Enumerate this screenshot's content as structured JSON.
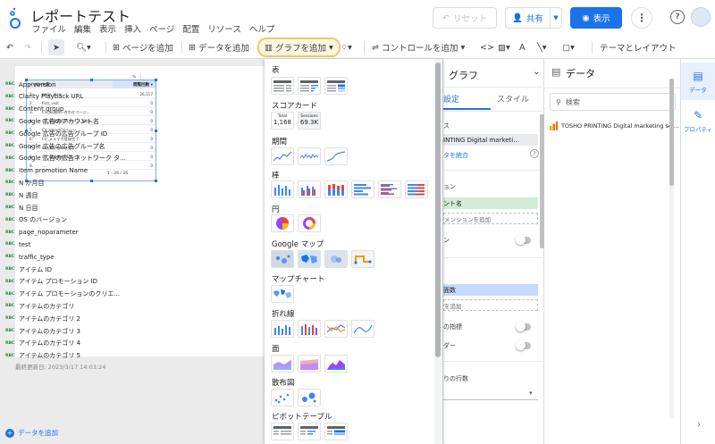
{
  "header": {
    "title": "レポートテスト",
    "menu": [
      "ファイル",
      "編集",
      "表示",
      "挿入",
      "ページ",
      "配置",
      "リソース",
      "ヘルプ"
    ],
    "reset_label": "リセット",
    "share_label": "共有",
    "view_label": "表示"
  },
  "toolbar": {
    "add_page": "ページを追加",
    "add_data": "データを追加",
    "add_chart": "グラフを追加",
    "add_control": "コントロールを追加",
    "theme_layout": "テーマとレイアウト"
  },
  "canvas": {
    "updated": "最終更新日: 2023/3/17 14:03:24",
    "table": {
      "col1": "イベント名",
      "col2": "閲覧回数 ▾",
      "rows": [
        {
          "n": "1.",
          "name": "page_view",
          "val": "26,117"
        },
        {
          "n": "2.",
          "name": "first_visit",
          "val": "0"
        },
        {
          "n": "3.",
          "name": "CV_新規問い合わせページ...",
          "val": "0"
        },
        {
          "n": "4.",
          "name": "CV_新規資料DLページ_資料...",
          "val": "0"
        },
        {
          "n": "5.",
          "name": "CV_aboutCVページ",
          "val": "0"
        },
        {
          "n": "6.",
          "name": "CV_メルマガ登録完了",
          "val": "0"
        },
        {
          "n": "7.",
          "name": "CV_問い合わせ完了",
          "val": "0"
        },
        {
          "n": "8.",
          "name": "CV_事業資料DLページ",
          "val": "0"
        },
        {
          "n": "9.",
          "name": "...",
          "val": "0"
        }
      ],
      "pager": "1 - 26 / 26"
    }
  },
  "chart_menu": {
    "categories": [
      "表",
      "スコアカード",
      "期間",
      "棒",
      "円",
      "Google マップ",
      "マップチャート",
      "折れ線",
      "面",
      "散布図",
      "ピボットテーブル"
    ],
    "scorecard": {
      "total_label": "Total",
      "total_value": "1,168",
      "sessions_label": "Sessions",
      "sessions_value": "69.3K"
    }
  },
  "properties": {
    "title": "グラフ",
    "tab_setup": "設定",
    "tab_style": "スタイル",
    "lines": {
      "source": "ス",
      "source_value": "INTING Digital marketi...",
      "merge": "タを統合",
      "dimension_h": "ョン",
      "dimension_value": "ント名",
      "add_dimension": "メンションを追加",
      "drill": "ン",
      "metric_value": "面数",
      "add_metric": "を追加",
      "optional": "の指標",
      "slider": "ダー",
      "rows": "りの行数"
    }
  },
  "data_panel": {
    "title": "データ",
    "search_placeholder": "検索",
    "source": "TOSHO PRINTING Digital marketing sol...",
    "fields": [
      "App version",
      "Clarity Playback URL",
      "Content group",
      "Google 広告のアカウント名",
      "Google 広告の広告グループ ID",
      "Google 広告の広告グループ名",
      "Google 広告の広告ネットワーク タ...",
      "Item promotion Name",
      "N か月目",
      "N 週目",
      "N 日目",
      "OS のバージョン",
      "page_noparameter",
      "test",
      "traffic_type",
      "アイテム ID",
      "アイテム プロモーション ID",
      "アイテム プロモーションのクリエ...",
      "アイテムのカテゴリ",
      "アイテムのカテゴリ 2",
      "アイテムのカテゴリ 3",
      "アイテムのカテゴリ 4",
      "アイテムのカテゴリ 5"
    ],
    "field_type": "RBC",
    "add_data": "データを追加"
  },
  "side_tabs": {
    "data": "データ",
    "props": "プロパティ"
  },
  "colors": {
    "accent": "#1a73e8",
    "highlight": "#f5c66b"
  }
}
